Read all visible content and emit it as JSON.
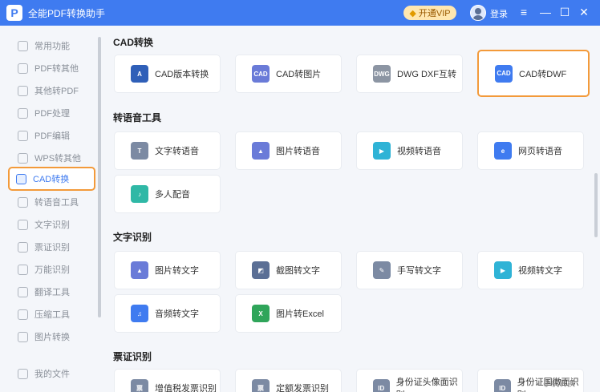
{
  "app": {
    "logo": "P",
    "title": "全能PDF转换助手"
  },
  "header": {
    "vip_label": "开通VIP",
    "login_label": "登录",
    "menu_icon": "≡",
    "min_icon": "—",
    "max_icon": "☐",
    "close_icon": "✕"
  },
  "sidebar": {
    "items": [
      {
        "label": "常用功能"
      },
      {
        "label": "PDF转其他"
      },
      {
        "label": "其他转PDF"
      },
      {
        "label": "PDF处理"
      },
      {
        "label": "PDF编辑"
      },
      {
        "label": "WPS转其他"
      },
      {
        "label": "CAD转换"
      },
      {
        "label": "转语音工具"
      },
      {
        "label": "文字识别"
      },
      {
        "label": "票证识别"
      },
      {
        "label": "万能识别"
      },
      {
        "label": "翻译工具"
      },
      {
        "label": "压缩工具"
      },
      {
        "label": "图片转换"
      },
      {
        "label": "我的文件"
      }
    ]
  },
  "sections": [
    {
      "title": "CAD转换",
      "cards": [
        {
          "label": "CAD版本转换",
          "icon": "cad-version-icon",
          "color": "#2f5fb8",
          "glyph": "A"
        },
        {
          "label": "CAD转图片",
          "icon": "cad-image-icon",
          "color": "#6a7bd8",
          "glyph": "CAD"
        },
        {
          "label": "DWG DXF互转",
          "icon": "dwg-dxf-icon",
          "color": "#8c95a3",
          "glyph": "DWG"
        },
        {
          "label": "CAD转DWF",
          "icon": "cad-dwf-icon",
          "color": "#3f7bf0",
          "glyph": "CAD"
        }
      ]
    },
    {
      "title": "转语音工具",
      "cards": [
        {
          "label": "文字转语音",
          "icon": "text-speech-icon",
          "color": "#7c8aa3",
          "glyph": "T"
        },
        {
          "label": "图片转语音",
          "icon": "image-speech-icon",
          "color": "#6a7bd8",
          "glyph": "▲"
        },
        {
          "label": "视频转语音",
          "icon": "video-speech-icon",
          "color": "#2fb3d6",
          "glyph": "▶"
        },
        {
          "label": "网页转语音",
          "icon": "web-speech-icon",
          "color": "#3f7bf0",
          "glyph": "e"
        },
        {
          "label": "多人配音",
          "icon": "multi-voice-icon",
          "color": "#2fb8a6",
          "glyph": "♪"
        }
      ]
    },
    {
      "title": "文字识别",
      "cards": [
        {
          "label": "图片转文字",
          "icon": "image-text-icon",
          "color": "#6a7bd8",
          "glyph": "▲"
        },
        {
          "label": "截图转文字",
          "icon": "screenshot-text-icon",
          "color": "#5b6f95",
          "glyph": "◩"
        },
        {
          "label": "手写转文字",
          "icon": "handwrite-text-icon",
          "color": "#7c8aa3",
          "glyph": "✎"
        },
        {
          "label": "视频转文字",
          "icon": "video-text-icon",
          "color": "#2fb3d6",
          "glyph": "▶"
        },
        {
          "label": "音频转文字",
          "icon": "audio-text-icon",
          "color": "#3f7bf0",
          "glyph": "♫"
        },
        {
          "label": "图片转Excel",
          "icon": "image-excel-icon",
          "color": "#2fa55a",
          "glyph": "X"
        }
      ]
    },
    {
      "title": "票证识别",
      "cards": [
        {
          "label": "增值税发票识别",
          "icon": "vat-invoice-icon",
          "color": "#7c8aa3",
          "glyph": "票"
        },
        {
          "label": "定额发票识别",
          "icon": "quota-invoice-icon",
          "color": "#7c8aa3",
          "glyph": "票"
        },
        {
          "label": "身份证头像面识别",
          "icon": "id-front-icon",
          "color": "#7c8aa3",
          "glyph": "ID"
        },
        {
          "label": "身份证国徽面识别",
          "icon": "id-back-icon",
          "color": "#7c8aa3",
          "glyph": "ID"
        }
      ]
    }
  ],
  "corner": {
    "label": "手机转换"
  }
}
